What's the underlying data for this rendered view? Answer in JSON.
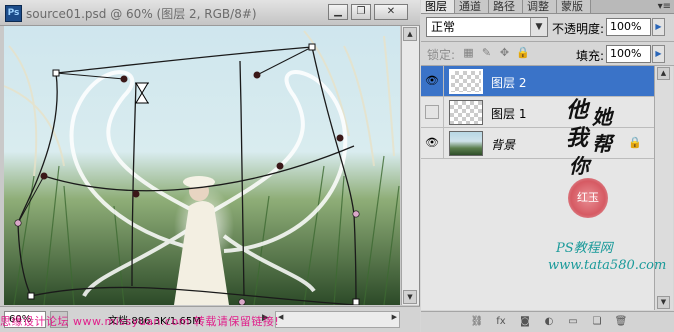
{
  "document": {
    "app_icon": "Ps",
    "title": "source01.psd @ 60% (图层 2, RGB/8#)",
    "window_buttons": {
      "minimize": "▁",
      "restore": "❐",
      "close": "✕"
    },
    "zoom": "60%",
    "doc_info": "文档:886.3K/1.65M",
    "watermark_text": "思缘设计论坛 www.missyuan.com  转载请保留链接!"
  },
  "layers_panel": {
    "tabs": [
      "图层",
      "通道",
      "路径",
      "调整",
      "蒙版"
    ],
    "active_tab": "图层",
    "blend_mode": "正常",
    "opacity_label": "不透明度:",
    "opacity_value": "100%",
    "lock_label": "锁定:",
    "fill_label": "填充:",
    "fill_value": "100%",
    "layers": [
      {
        "name": "图层 2",
        "visible": true,
        "selected": true
      },
      {
        "name": "图层 1",
        "visible": false,
        "selected": false
      },
      {
        "name": "背景",
        "visible": true,
        "selected": false,
        "locked": true
      }
    ],
    "footer_icons": [
      "link-icon",
      "fx-icon",
      "mask-icon",
      "adjustment-icon",
      "folder-icon",
      "new-layer-icon",
      "trash-icon"
    ]
  },
  "watermark": {
    "calligraphy": [
      "他",
      "她",
      "我",
      "帮",
      "你"
    ],
    "seal": "红玉",
    "ps_text": "PS教程网",
    "site": "www.tata580.com"
  },
  "colors": {
    "selection": "#3a73c8",
    "watermark_pink": "#e3007f",
    "watermark_teal": "#1a9a9a"
  }
}
